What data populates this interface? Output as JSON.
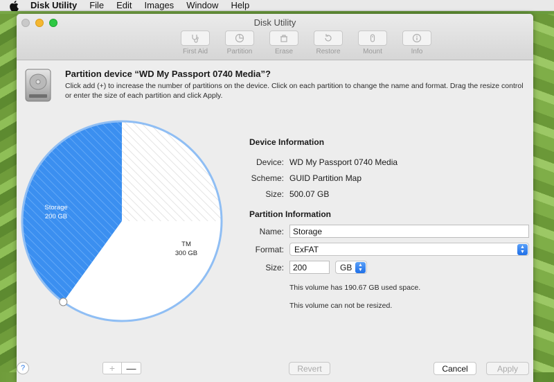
{
  "menubar": {
    "app_name": "Disk Utility",
    "items": [
      "File",
      "Edit",
      "Images",
      "Window",
      "Help"
    ]
  },
  "window": {
    "title": "Disk Utility",
    "toolbar": [
      {
        "label": "First Aid",
        "icon": "stethoscope-icon"
      },
      {
        "label": "Partition",
        "icon": "partition-icon"
      },
      {
        "label": "Erase",
        "icon": "erase-icon"
      },
      {
        "label": "Restore",
        "icon": "restore-icon"
      },
      {
        "label": "Mount",
        "icon": "mount-icon"
      },
      {
        "label": "Info",
        "icon": "info-icon"
      }
    ]
  },
  "sheet": {
    "title": "Partition device “WD My Passport 0740 Media”?",
    "description": "Click add (+) to increase the number of partitions on the device. Click on each partition to change the name and format. Drag the resize control or enter the size of each partition and click Apply."
  },
  "pie": {
    "partitions": [
      {
        "name": "Storage",
        "size_label": "200 GB",
        "size_gb": 200,
        "selected": true
      },
      {
        "name": "TM",
        "size_label": "300 GB",
        "size_gb": 300,
        "selected": false
      }
    ],
    "colors": {
      "selected": "#3b8ff0",
      "selected_hatch": "#62a8f7",
      "border": "#8fbef4",
      "unselected": "#ffffff"
    }
  },
  "device_info": {
    "heading": "Device Information",
    "rows": [
      {
        "key": "Device:",
        "value": "WD My Passport 0740 Media"
      },
      {
        "key": "Scheme:",
        "value": "GUID Partition Map"
      },
      {
        "key": "Size:",
        "value": "500.07 GB"
      }
    ]
  },
  "partition_info": {
    "heading": "Partition Information",
    "name_label": "Name:",
    "name_value": "Storage",
    "format_label": "Format:",
    "format_value": "ExFAT",
    "size_label": "Size:",
    "size_value": "200",
    "unit_value": "GB",
    "used_note": "This volume has 190.67 GB used space.",
    "resize_note": "This volume can not be resized."
  },
  "buttons": {
    "help": "?",
    "add": "+",
    "remove": "—",
    "revert": "Revert",
    "cancel": "Cancel",
    "apply": "Apply"
  }
}
